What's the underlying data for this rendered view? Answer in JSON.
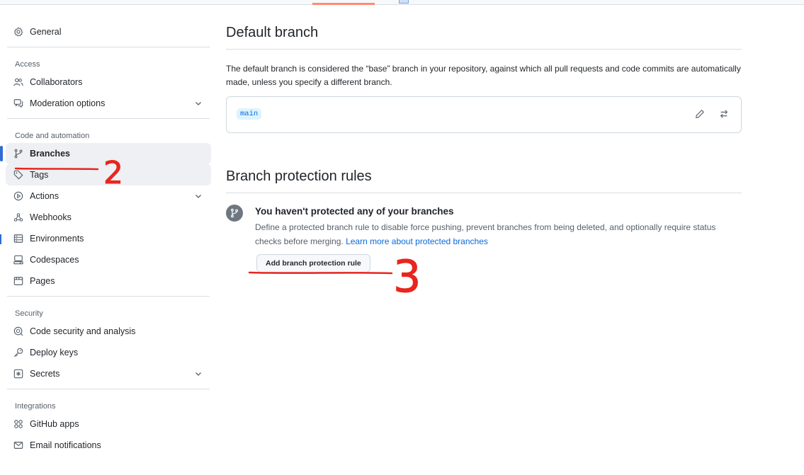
{
  "sidebar": {
    "general": "General",
    "groups": {
      "access": "Access",
      "code": "Code and automation",
      "security": "Security",
      "integrations": "Integrations"
    },
    "items": {
      "collaborators": "Collaborators",
      "moderation": "Moderation options",
      "branches": "Branches",
      "tags": "Tags",
      "actions": "Actions",
      "webhooks": "Webhooks",
      "environments": "Environments",
      "codespaces": "Codespaces",
      "pages": "Pages",
      "code_security": "Code security and analysis",
      "deploy_keys": "Deploy keys",
      "secrets": "Secrets",
      "github_apps": "GitHub apps",
      "email_notifications": "Email notifications"
    },
    "selected": "branches"
  },
  "default_branch": {
    "heading": "Default branch",
    "description": "The default branch is considered the “base” branch in your repository, against which all pull requests and code commits are automatically made, unless you specify a different branch.",
    "branch_name": "main"
  },
  "protection": {
    "heading": "Branch protection rules",
    "empty_title": "You haven't protected any of your branches",
    "empty_body": "Define a protected branch rule to disable force pushing, prevent branches from being deleted, and optionally require status checks before merging.",
    "learn_more": "Learn more about protected branches",
    "add_button": "Add branch protection rule"
  },
  "annotations": {
    "step_2": "2",
    "step_3": "3",
    "color": "#e8261e"
  },
  "colors": {
    "accent": "#2f6bd9",
    "link": "#0969da",
    "tab_underline": "#fd8c73"
  }
}
